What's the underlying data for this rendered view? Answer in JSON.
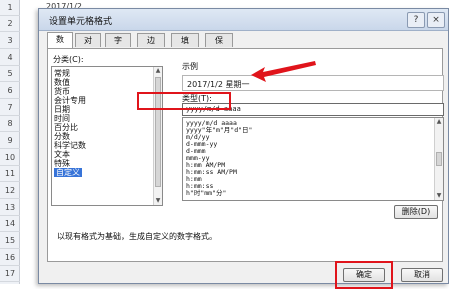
{
  "sheet": {
    "a1_value": "2017/1/2",
    "row_numbers": [
      "1",
      "2",
      "3",
      "4",
      "5",
      "6",
      "7",
      "8",
      "9",
      "10",
      "11",
      "12",
      "13",
      "14",
      "15",
      "16",
      "17"
    ]
  },
  "dialog": {
    "title": "设置单元格格式",
    "help_label": "?",
    "close_label": "×",
    "tabs": [
      "数字",
      "对齐",
      "字体",
      "边框",
      "填充",
      "保护"
    ],
    "category_label": "分类(C):",
    "categories": [
      "常规",
      "数值",
      "货币",
      "会计专用",
      "日期",
      "时间",
      "百分比",
      "分数",
      "科学记数",
      "文本",
      "特殊",
      "自定义"
    ],
    "selected_category": "自定义",
    "sample_label": "示例",
    "sample_value": "2017/1/2  星期一",
    "type_label": "类型(T):",
    "type_value": "yyyy/m/d  aaaa",
    "formats": [
      "yyyy/m/d  aaaa",
      "yyyy\"年\"m\"月\"d\"日\"",
      "m/d/yy",
      "d-mmm-yy",
      "d-mmm",
      "mmm-yy",
      "h:mm AM/PM",
      "h:mm:ss AM/PM",
      "h:mm",
      "h:mm:ss",
      "h\"时\"mm\"分\""
    ],
    "delete_label": "删除(D)",
    "description": "以现有格式为基础，生成自定义的数字格式。",
    "ok_label": "确定",
    "cancel_label": "取消"
  },
  "annotation_color": "#e0141b",
  "selection_color": "#3874d8"
}
